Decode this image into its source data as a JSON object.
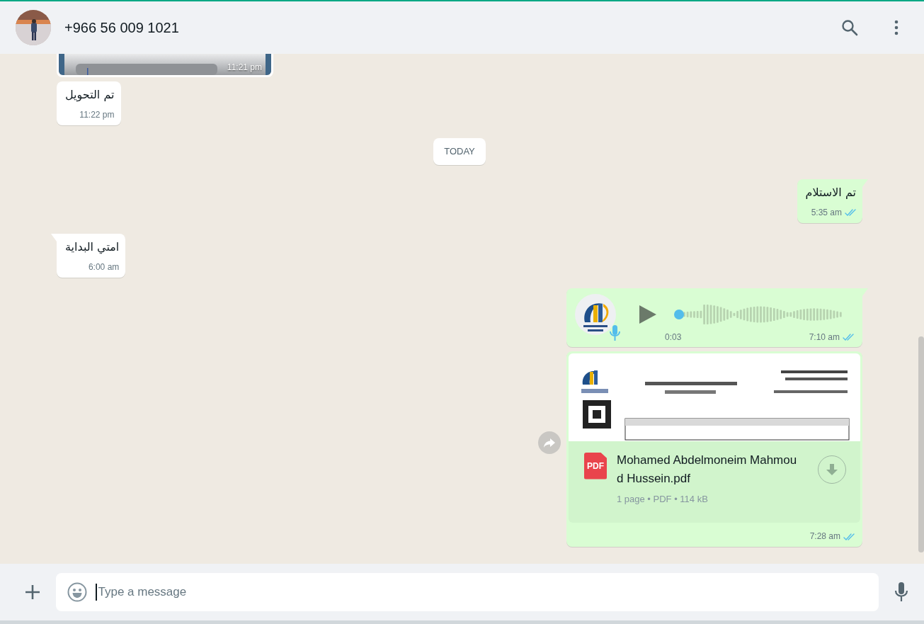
{
  "header": {
    "contact": "+966 56 009 1021"
  },
  "messages": [
    {
      "outgoing": false,
      "time": "11:21 pm"
    },
    {
      "kind": "text",
      "outgoing": false,
      "text": "تم التحويل",
      "time": "11:22 pm",
      "tail": false
    },
    {
      "kind": "date",
      "text": "TODAY"
    },
    {
      "kind": "text",
      "outgoing": true,
      "text": "تم الاستلام",
      "time": "5:35 am",
      "tail": true,
      "read": true
    },
    {
      "kind": "text",
      "outgoing": false,
      "text": "امتي البداية",
      "time": "6:00 am",
      "tail": true
    },
    {
      "kind": "voice",
      "outgoing": true,
      "duration": "0:03",
      "time": "7:10 am",
      "tail": true,
      "read": true,
      "level": 0
    },
    {
      "kind": "document",
      "outgoing": true,
      "file_name": "Mohamed Abdelmoneim Mahmoud Hussein.pdf",
      "icon_label": "PDF",
      "details": "1 page • PDF • 114 kB",
      "time": "7:28 am",
      "tail": false,
      "read": true
    }
  ],
  "composer": {
    "placeholder": "Type a message"
  }
}
